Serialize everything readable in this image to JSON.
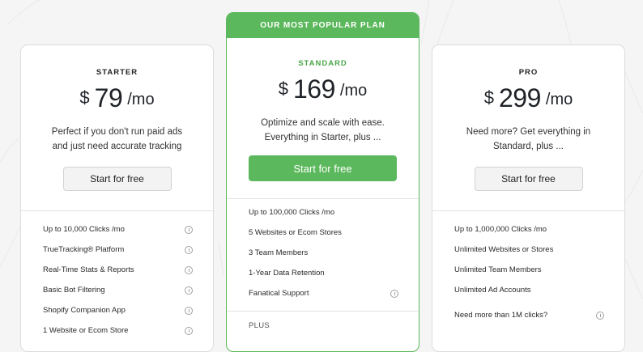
{
  "plans": {
    "starter": {
      "name": "STARTER",
      "currency": "$",
      "price": "79",
      "period": "/mo",
      "desc_line1": "Perfect if you don't run paid ads",
      "desc_line2": "and just need accurate tracking",
      "cta": "Start for free",
      "features": [
        "Up to 10,000 Clicks /mo",
        "TrueTracking® Platform",
        "Real-Time Stats & Reports",
        "Basic Bot Filtering",
        "Shopify Companion App",
        "1 Website or Ecom Store"
      ]
    },
    "standard": {
      "banner": "OUR MOST POPULAR PLAN",
      "name": "STANDARD",
      "currency": "$",
      "price": "169",
      "period": "/mo",
      "desc_line1": "Optimize and scale with ease.",
      "desc_line2": "Everything in Starter, plus ...",
      "cta": "Start for free",
      "features": [
        "Up to 100,000 Clicks /mo",
        "5 Websites or Ecom Stores",
        "3 Team Members",
        "1-Year Data Retention",
        "Fanatical Support"
      ],
      "plus_label": "PLUS"
    },
    "pro": {
      "name": "PRO",
      "currency": "$",
      "price": "299",
      "period": "/mo",
      "desc_line1": "Need more? Get everything in",
      "desc_line2": "Standard, plus ...",
      "cta": "Start for free",
      "features": [
        "Up to 1,000,000 Clicks /mo",
        "Unlimited Websites or Stores",
        "Unlimited Team Members",
        "Unlimited Ad Accounts",
        "Need more than 1M clicks?"
      ]
    }
  },
  "colors": {
    "accent": "#5cb85c",
    "background": "#f5f5f5",
    "card": "#ffffff"
  }
}
